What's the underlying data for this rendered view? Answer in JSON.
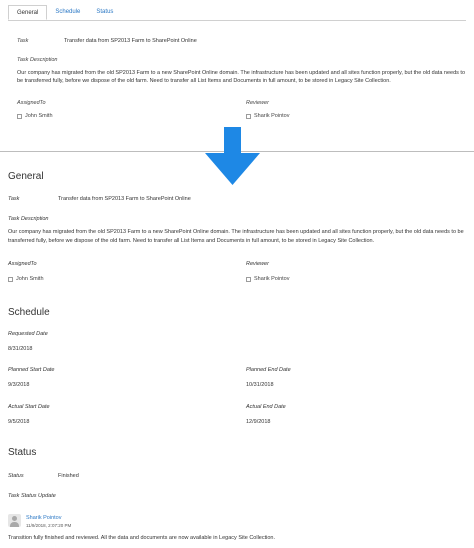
{
  "top_form": {
    "tabs": [
      "General",
      "Schedule",
      "Status"
    ],
    "task_label": "Task",
    "task_value": "Transfer data from SP2013 Farm to SharePoint Online",
    "description_label": "Task Description",
    "description": "Our company has migrated from the old SP2013 Farm to a new SharePoint Online domain. The infrastructure has been updated and all sites function properly, but the old data needs to be transferred fully, before we dispose of the old farm. Need to transfer all List Items and Documents in full amount, to be stored in Legacy Site Collection.",
    "assigned_label": "AssignedTo",
    "assigned_value": "John Smith",
    "reviewer_label": "Reviewer",
    "reviewer_value": "Sharik Pointov"
  },
  "arrow": {
    "color": "#1e88e5",
    "icon": "arrow-down-icon"
  },
  "general": {
    "heading": "General",
    "task_label": "Task",
    "task_value": "Transfer data from SP2013 Farm to SharePoint Online",
    "description_label": "Task Description",
    "description": "Our company has migrated from the old SP2013 Farm to a new SharePoint Online domain. The infrastructure has been updated and all sites function properly, but the old data needs to be transferred fully, before we dispose of the old farm. Need to transfer all List Items and Documents in full amount, to be stored in Legacy Site Collection.",
    "assigned_label": "AssignedTo",
    "assigned_value": "John Smith",
    "reviewer_label": "Reviewer",
    "reviewer_value": "Sharik Pointov"
  },
  "schedule": {
    "heading": "Schedule",
    "requested_label": "Requested Date",
    "requested_value": "8/31/2018",
    "planned_start_label": "Planned Start Date",
    "planned_start_value": "9/3/2018",
    "planned_end_label": "Planned End Date",
    "planned_end_value": "10/31/2018",
    "actual_start_label": "Actual Start Date",
    "actual_start_value": "9/5/2018",
    "actual_end_label": "Actual End Date",
    "actual_end_value": "12/9/2018"
  },
  "status": {
    "heading": "Status",
    "status_label": "Status",
    "status_value": "Finished",
    "update_label": "Task Status Update",
    "author": "Sharik Pointov",
    "timestamp": "11/9/2018, 2:07:20 PM",
    "message": "Transition fully finished and reviewed. All the data and documents are now available in Legacy Site Collection."
  }
}
